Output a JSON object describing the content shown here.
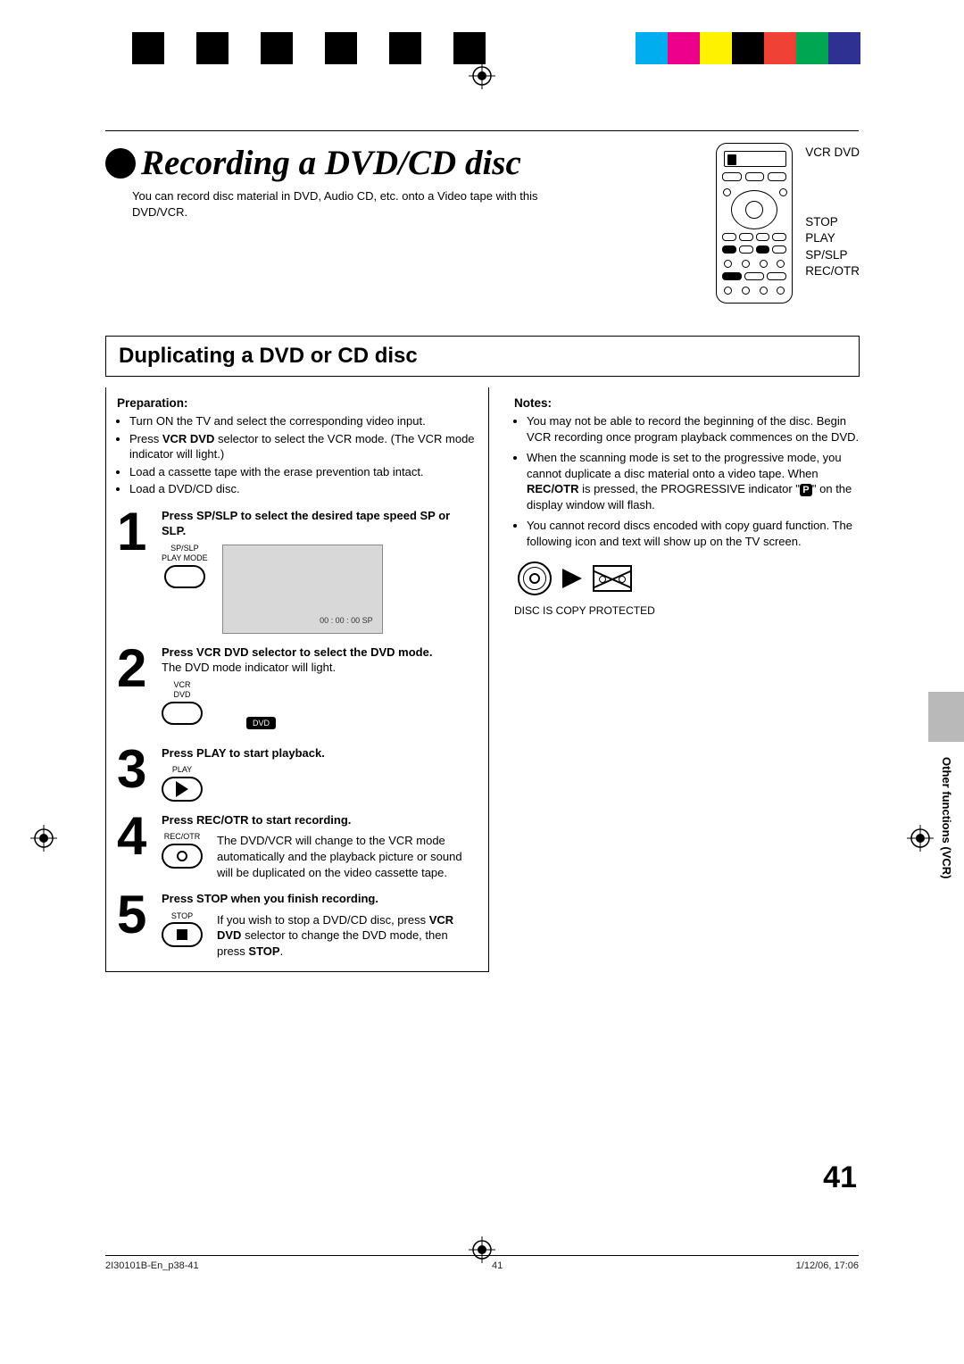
{
  "colorbar_left": [
    "#000",
    "#fff",
    "#000",
    "#fff",
    "#000",
    "#fff",
    "#000",
    "#fff",
    "#000",
    "#fff",
    "#000"
  ],
  "colorbar_right": [
    "#00aeef",
    "#ec008c",
    "#fff200",
    "#000",
    "#ef4136",
    "#00a651",
    "#2e3192",
    "#fff"
  ],
  "title": "Recording a DVD/CD disc",
  "intro": "You can record disc material in DVD, Audio CD, etc. onto a Video tape with this DVD/VCR.",
  "remote_labels": {
    "vcrdvd": "VCR DVD",
    "stop": "STOP",
    "play": "PLAY",
    "spslp": "SP/SLP",
    "recotr": "REC/OTR"
  },
  "section_title": "Duplicating a DVD or CD disc",
  "preparation_heading": "Preparation",
  "preparation": [
    "Turn ON the TV and select the corresponding video input.",
    "Press <b>VCR DVD</b> selector to select the VCR mode. (The VCR mode indicator will light.)",
    "Load a cassette tape with the erase prevention tab intact.",
    "Load a DVD/CD disc."
  ],
  "steps": {
    "s1": {
      "title": "Press SP/SLP to select the desired tape speed SP or SLP.",
      "btn_lbl1": "SP/SLP",
      "btn_lbl2": "PLAY MODE",
      "osd": "00 : 00 : 00  SP"
    },
    "s2": {
      "title": "Press VCR DVD selector to select the DVD mode.",
      "body": "The DVD mode indicator will light.",
      "btn_lbl1": "VCR",
      "btn_lbl2": "DVD",
      "pill": "DVD"
    },
    "s3": {
      "title": "Press PLAY to start playback.",
      "btn_lbl": "PLAY"
    },
    "s4": {
      "title": "Press REC/OTR to start recording.",
      "body": "The DVD/VCR will change to the VCR mode automatically and the playback picture or sound will be duplicated on the video cassette tape.",
      "btn_lbl": "REC/OTR"
    },
    "s5": {
      "title": "Press STOP when you finish recording.",
      "body_pre": "If you wish to stop a DVD/CD disc, press ",
      "body_b1": "VCR DVD",
      "body_mid": " selector to change the DVD mode, then press ",
      "body_b2": "STOP",
      "body_post": ".",
      "btn_lbl": "STOP"
    }
  },
  "notes_heading": "Notes",
  "notes": {
    "n1": "You may not be able to record the beginning of the disc. Begin VCR recording once program playback commences on the DVD.",
    "n2a": "When the scanning mode is set to the progressive mode, you cannot duplicate a disc material onto a video tape. When ",
    "n2b": "REC/OTR",
    "n2c": " is pressed, the PROGRESSIVE indicator \"",
    "n2d": "\" on the display window will flash.",
    "n3": "You cannot record discs encoded with copy guard function. The following icon and text will show up on the TV screen."
  },
  "p_icon": "P",
  "copy_protected": "DISC IS COPY PROTECTED",
  "side_label": "Other functions (VCR)",
  "page_number": "41",
  "footer": {
    "left": "2I30101B-En_p38-41",
    "center": "41",
    "right": "1/12/06, 17:06"
  }
}
